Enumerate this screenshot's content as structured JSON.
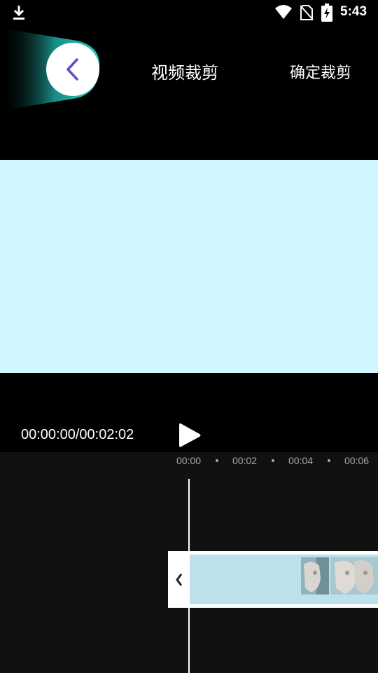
{
  "status_bar": {
    "time": "5:43",
    "icons": [
      "download-icon",
      "wifi-icon",
      "no-sim-icon",
      "battery-charging-icon"
    ]
  },
  "header": {
    "title": "视频裁剪",
    "confirm_label": "确定裁剪",
    "back_icon": "chevron-left-icon"
  },
  "colors": {
    "accent": "#5b4fd0",
    "preview_bg": "#cff7fd",
    "glow": "#2ad0c0",
    "clip": "#bde1ea",
    "timeline_bg": "#111111"
  },
  "playback": {
    "timecode": "00:00:00/00:02:02",
    "play_icon": "play-icon"
  },
  "timeline": {
    "ticks": [
      "00:00",
      "00:02",
      "00:04",
      "00:06"
    ],
    "handle_icon": "chevron-left-icon"
  }
}
